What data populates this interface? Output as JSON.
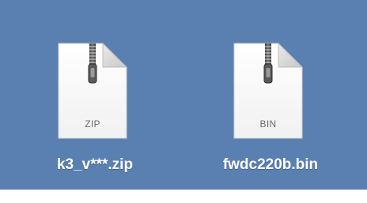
{
  "desktop": {
    "background_color": "#5a80b2",
    "files": [
      {
        "name": "k3_v***.zip",
        "extension_label": "ZIP",
        "icon": "zip-document-icon"
      },
      {
        "name": "fwdc220b.bin",
        "extension_label": "BIN",
        "icon": "bin-document-icon"
      }
    ]
  }
}
